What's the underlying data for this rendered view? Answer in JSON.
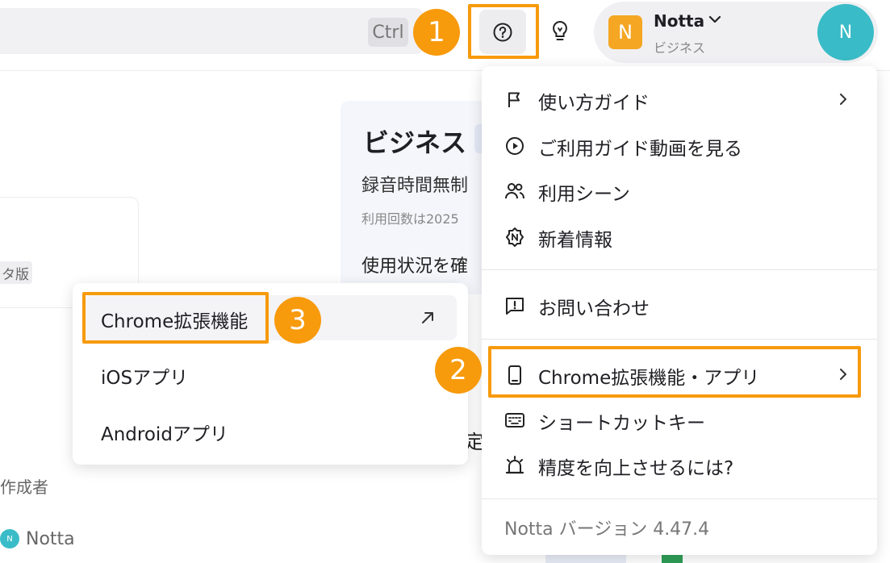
{
  "header": {
    "search_shortcut": "Ctrl",
    "help_icon": "question-circle-icon",
    "tips_icon": "lightbulb-icon",
    "user": {
      "logo_letter": "N",
      "name": "Notta",
      "plan": "ビジネス",
      "avatar_letter": "N"
    }
  },
  "background": {
    "plan_title": "ビジネス",
    "plan_line1": "録音時間無制",
    "plan_line2": "利用回数は2025",
    "plan_line3": "使用状況を確",
    "fragment_char": "定",
    "beta_tag": "タ版",
    "creator_label": "作成者",
    "creator_mini": "N",
    "creator_name": "Notta"
  },
  "help_menu": {
    "items": [
      {
        "label": "使い方ガイド",
        "icon": "flag-icon",
        "has_submenu": true
      },
      {
        "label": "ご利用ガイド動画を見る",
        "icon": "play-circle-icon",
        "has_submenu": false
      },
      {
        "label": "利用シーン",
        "icon": "users-icon",
        "has_submenu": false
      },
      {
        "label": "新着情報",
        "icon": "new-badge-icon",
        "has_submenu": false
      },
      {
        "label": "お問い合わせ",
        "icon": "message-alert-icon",
        "has_submenu": false
      },
      {
        "label": "Chrome拡張機能・アプリ",
        "icon": "mobile-icon",
        "has_submenu": true
      },
      {
        "label": "ショートカットキー",
        "icon": "keyboard-icon",
        "has_submenu": false
      },
      {
        "label": "精度を向上させるには?",
        "icon": "alarm-icon",
        "has_submenu": false
      }
    ],
    "version": "Notta バージョン 4.47.4"
  },
  "sub_menu": {
    "items": [
      {
        "label": "Chrome拡張機能",
        "external": true
      },
      {
        "label": "iOSアプリ",
        "external": false
      },
      {
        "label": "Androidアプリ",
        "external": false
      }
    ]
  },
  "annotations": {
    "badges": [
      "1",
      "2",
      "3"
    ],
    "color": "#f79a0c"
  }
}
